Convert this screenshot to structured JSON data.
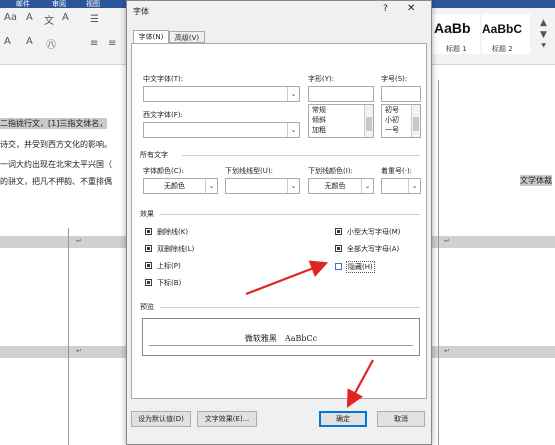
{
  "word": {
    "ribbon_tabs": [
      "邮件",
      "审阅",
      "视图"
    ],
    "styles": [
      {
        "sample": "AaBb",
        "label": "标题 1"
      },
      {
        "sample": "AaBbC",
        "label": "标题 2"
      },
      {
        "sample": "",
        "label": ""
      }
    ],
    "doc_lines": [
      "二指拢行文，[1]三指文体名，",
      "诗交，并受到西方文化的影响。",
      "一词大约出现在北宋太平兴国（",
      "的骈文，把凡不押韵、不重排偶",
      "文学体裁"
    ]
  },
  "dialog": {
    "title": "字体",
    "help": "?",
    "close": "✕",
    "tabs": [
      "字体(N)",
      "高级(V)"
    ],
    "chinese_font_label": "中文字体(T):",
    "western_font_label": "西文字体(F):",
    "style_label": "字形(Y):",
    "size_label": "字号(S):",
    "styles": [
      "常规",
      "倾斜",
      "加粗"
    ],
    "sizes": [
      "初号",
      "小初",
      "一号"
    ],
    "all_text_label": "所有文字",
    "font_color_label": "字体颜色(C):",
    "font_color_value": "无颜色",
    "underline_style_label": "下划线线型(U):",
    "underline_color_label": "下划线颜色(I):",
    "underline_color_value": "无颜色",
    "emphasis_label": "着重号(·):",
    "effects_label": "效果",
    "effects_left": [
      {
        "label": "删除线(K)",
        "checked": true
      },
      {
        "label": "双删除线(L)",
        "checked": true
      },
      {
        "label": "上标(P)",
        "checked": true
      },
      {
        "label": "下标(B)",
        "checked": true
      }
    ],
    "effects_right": [
      {
        "label": "小型大写字母(M)",
        "checked": true
      },
      {
        "label": "全部大写字母(A)",
        "checked": true
      },
      {
        "label": "隐藏(H)",
        "checked": false
      }
    ],
    "preview_label": "预览",
    "preview_text": "微软雅黑　AaBbCc",
    "set_default": "设为默认值(D)",
    "text_effects": "文字效果(E)...",
    "ok": "确定",
    "cancel": "取消"
  },
  "colors": {
    "arrow": "#e02424",
    "accent": "#0078d7"
  }
}
